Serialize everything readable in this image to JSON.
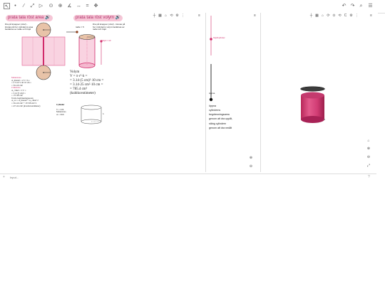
{
  "toolbar": {
    "tools": [
      "↖",
      "•",
      "⁄",
      "⤢",
      "▷",
      "⊙",
      "⊕",
      "∡",
      "↔",
      "=",
      "✥"
    ],
    "right": {
      "undo": "↶",
      "redo": "↷",
      "search": "⌕",
      "menu": "☰"
    }
  },
  "left_panel": {
    "pill_area": "prata tala röst area",
    "pill_volume": "prata tala röst volym",
    "instructions_area": "Dra på knappen (vita!) - lösnas på hur cylinderns area beräknas av radie och höjd",
    "instructions_volume": "Dra på knappen (vita!) - lösnas på hur cylinderns volym beräknas av radie och höjd",
    "radie_label": "radie = 5",
    "hojd_label": "höjd = 10",
    "area_lines": [
      "Mantelarea",
      "A_mantel = 2·π·r·h =",
      "= 2·3.14·5 cm·10 cm =",
      "= 314.16 cm²",
      "Cirkelarea",
      "A_cirkel = π·r² =",
      "= 3.14·(5 cm)² =",
      "= 157.08 cm²",
      "Totala begränsningsarean",
      "A_tot = A_mantel + A_cirkel·2",
      "= 314.16 cm² + 157.08 cm²·2",
      "= 471.24 cm² (kvadratcentimeter)"
    ],
    "volume_heading": "Volym",
    "volume_lines": [
      "V = π·r²·h =",
      "= 3.14·(5 cm)²·10 cm =",
      "= 3.14·25 cm²·10 cm =",
      "= 785.4 cm³",
      "(kubikcentimeter)"
    ],
    "cylinder_box_title": "Cylinder",
    "cylinder_box_lines": [
      "V = πr²h",
      "Mantelarea",
      "A = 2πrh"
    ]
  },
  "middle_panel": {
    "slider1_label": "höjdCylinder",
    "slider2_label": "öppna",
    "options": [
      "öppna",
      "cylinderns",
      "begränsningsarea",
      "genom att dra uppåt,",
      "stäng cylindern",
      "genom att dra nedåt"
    ]
  },
  "right_panel": {},
  "input": {
    "placeholder": "Input..."
  },
  "colors": {
    "accent": "#d12b6a",
    "pink_fill": "#f4a8c4",
    "dark": "#222222"
  }
}
